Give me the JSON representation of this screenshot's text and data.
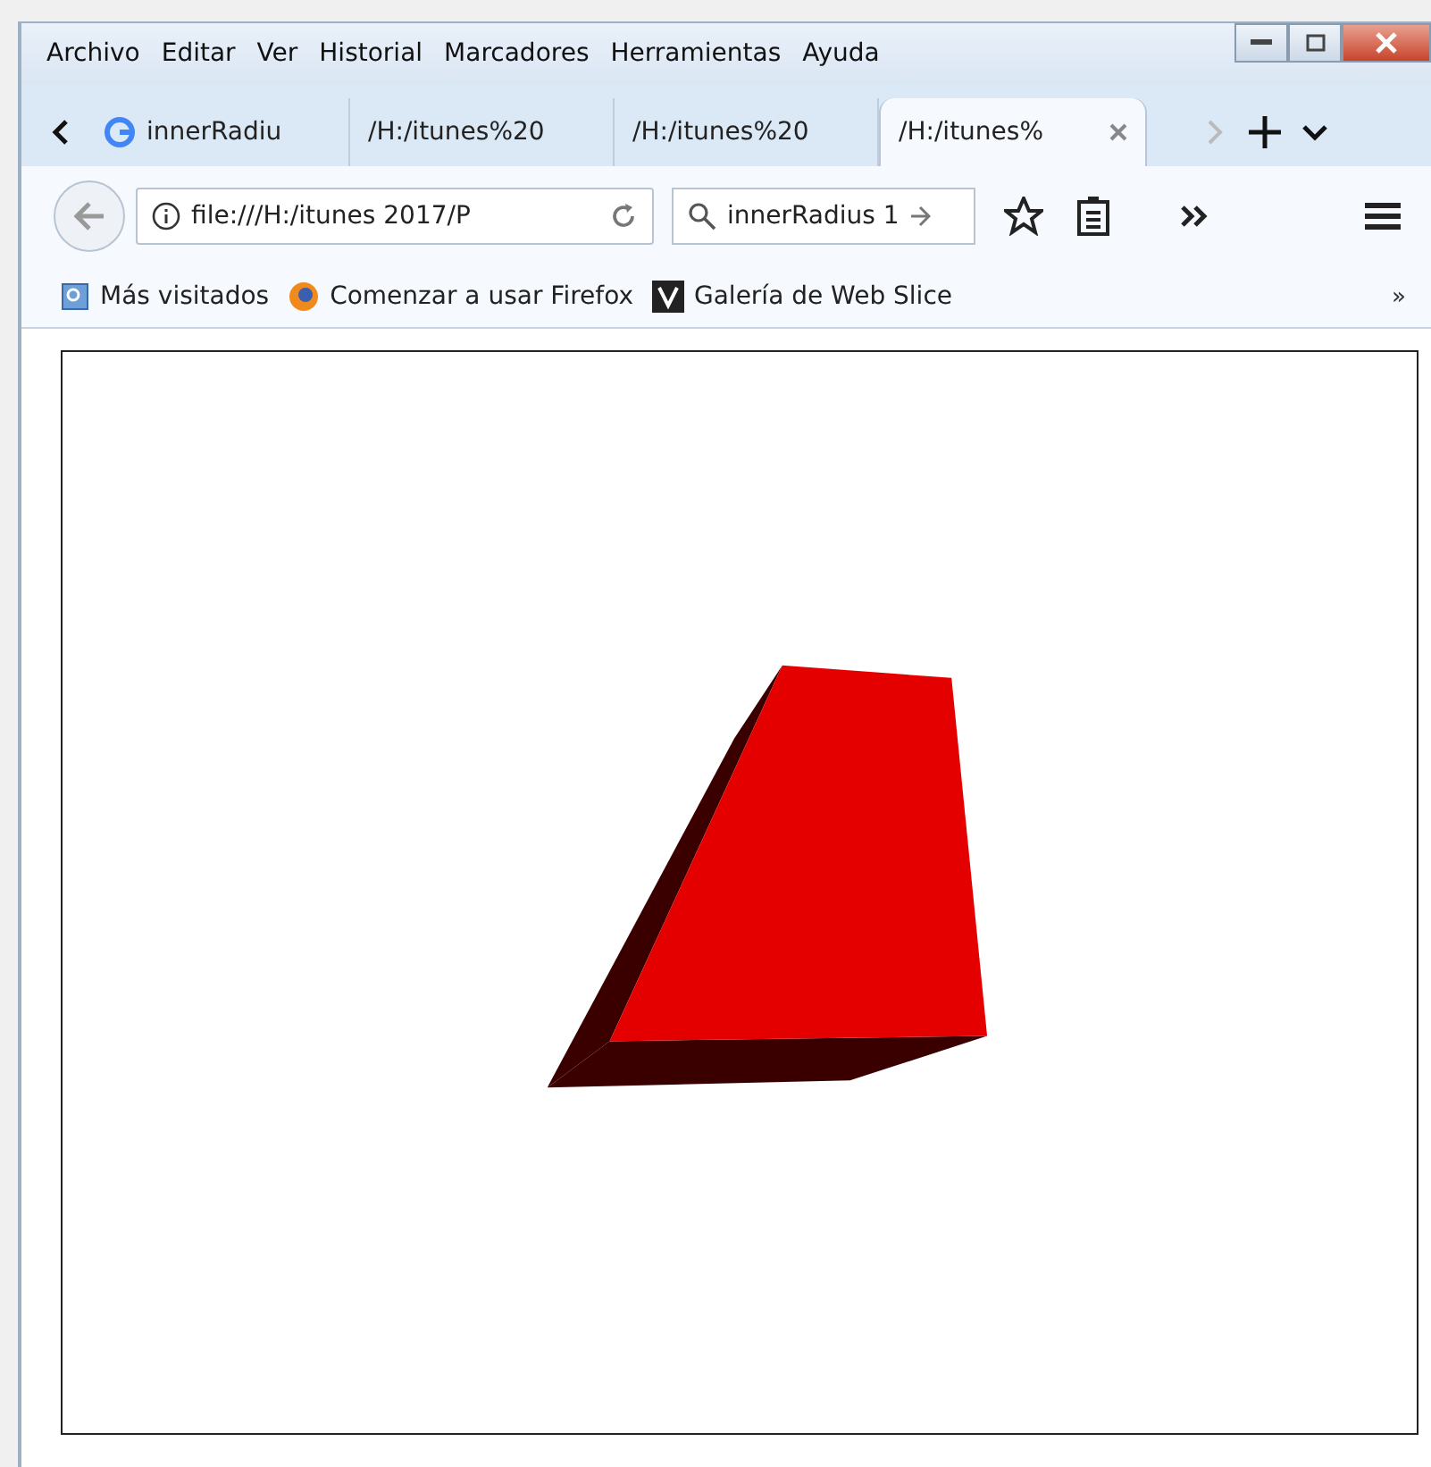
{
  "menu_bar": {
    "items": [
      {
        "label": "Archivo"
      },
      {
        "label": "Editar"
      },
      {
        "label": "Ver"
      },
      {
        "label": "Historial"
      },
      {
        "label": "Marcadores"
      },
      {
        "label": "Herramientas"
      },
      {
        "label": "Ayuda"
      }
    ]
  },
  "tabs": [
    {
      "label": "innerRadiu",
      "favicon": true,
      "selected": false
    },
    {
      "label": "/H:/itunes%20",
      "favicon": false,
      "selected": false
    },
    {
      "label": "/H:/itunes%20",
      "favicon": false,
      "selected": false
    },
    {
      "label": "/H:/itunes%",
      "favicon": false,
      "selected": true
    }
  ],
  "address_bar": {
    "value": "file:///H:/itunes 2017/P"
  },
  "search_bar": {
    "value": "innerRadius 1"
  },
  "bookmarks": [
    {
      "label": "Más visitados",
      "kind": "folder"
    },
    {
      "label": "Comenzar a usar Firefox",
      "kind": "firefox"
    },
    {
      "label": "Galería de Web Slice",
      "kind": "slice"
    }
  ],
  "bookmarks_overflow": "»"
}
